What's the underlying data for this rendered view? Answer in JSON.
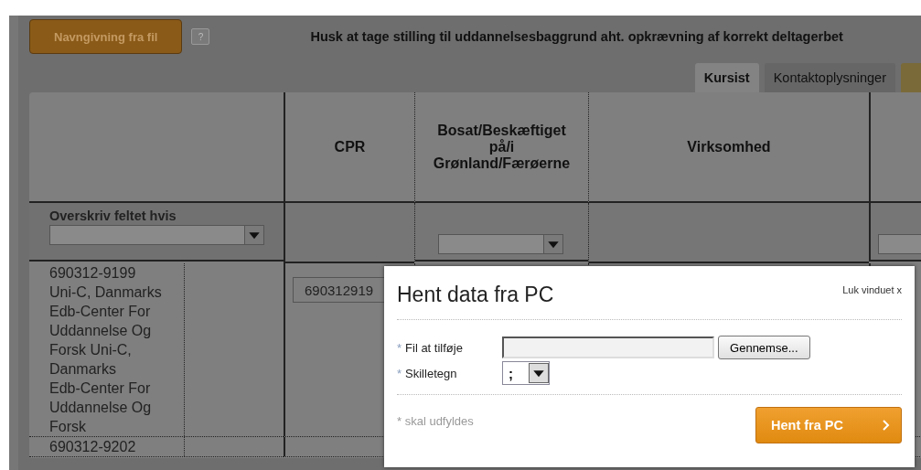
{
  "toolbar": {
    "import_button": "Navngivning fra fil",
    "help_button": "?",
    "notice": "Husk at tage stilling til uddannelsesbaggrund aht. opkrævning af korrekt deltagerbet"
  },
  "tabs": [
    {
      "label": "Kursist",
      "selected": true
    },
    {
      "label": "Kontaktoplysninger",
      "selected": false
    }
  ],
  "table": {
    "columns": [
      "CPR",
      "Bosat/Beskæftiget på/i Grønland/Færøerne",
      "Virksomhed"
    ],
    "filter_label": "Overskriv feltet hvis",
    "rows": [
      {
        "person": "690312-9199\nUni-C, Danmarks\nEdb-Center For\nUddannelse Og\nForsk Uni-C,\nDanmarks\nEdb-Center For\nUddannelse Og\nForsk",
        "cpr": "690312919"
      },
      {
        "person": "690312-9202"
      }
    ]
  },
  "dialog": {
    "title": "Hent data fra PC",
    "close": "Luk vinduet x",
    "fields": [
      {
        "kind": "file",
        "marker": "*",
        "label": "Fil at tilføje",
        "button": "Gennemse..."
      },
      {
        "kind": "select",
        "marker": "*",
        "label": "Skilletegn",
        "value": ";"
      }
    ],
    "footnote": "* skal udfyldes",
    "submit": "Hent fra PC"
  }
}
